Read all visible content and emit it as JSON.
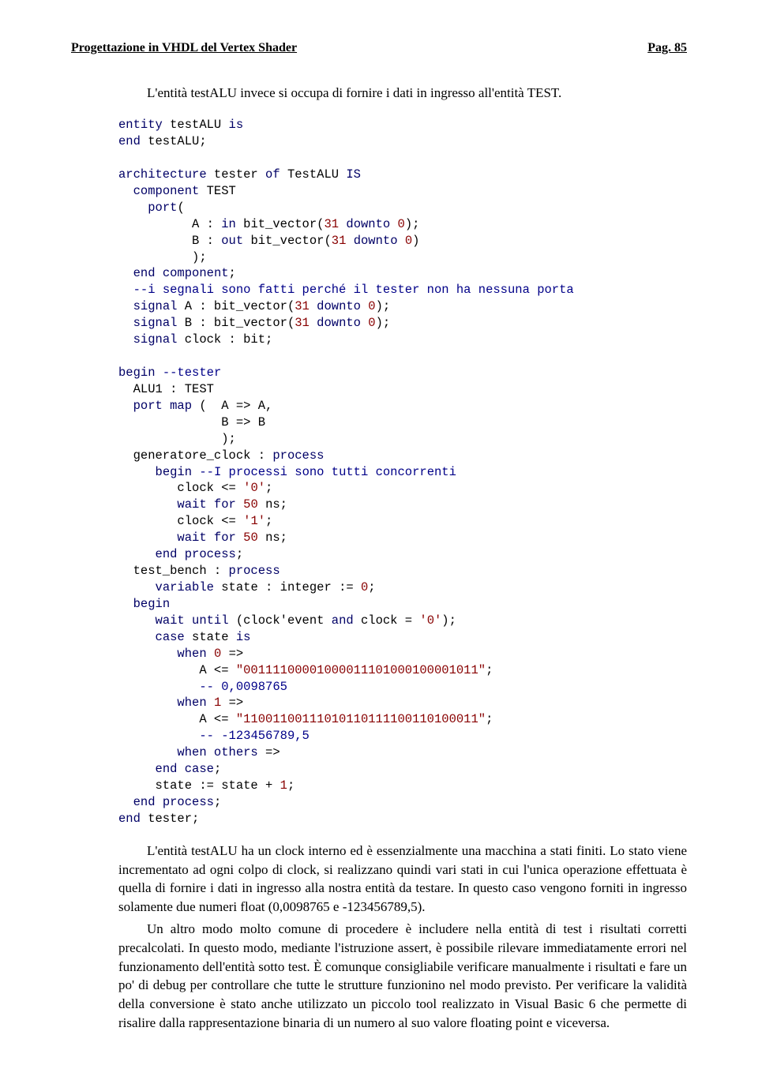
{
  "header": {
    "left": "Progettazione in VHDL del Vertex Shader",
    "right": "Pag. 85"
  },
  "para1_lead": "L'entità testALU invece si occupa di fornire i dati in ingresso all'entità TEST.",
  "code_lines": [
    [
      {
        "t": "entity",
        "c": "c-kw"
      },
      {
        "t": " testALU "
      },
      {
        "t": "is",
        "c": "c-kw"
      }
    ],
    [
      {
        "t": "end",
        "c": "c-kw"
      },
      {
        "t": " testALU;"
      }
    ],
    [],
    [
      {
        "t": "architecture",
        "c": "c-kw"
      },
      {
        "t": " tester "
      },
      {
        "t": "of",
        "c": "c-kw"
      },
      {
        "t": " TestALU "
      },
      {
        "t": "IS",
        "c": "c-kw"
      }
    ],
    [
      {
        "t": "  "
      },
      {
        "t": "component",
        "c": "c-kw"
      },
      {
        "t": " TEST"
      }
    ],
    [
      {
        "t": "    "
      },
      {
        "t": "port",
        "c": "c-kw"
      },
      {
        "t": "("
      }
    ],
    [
      {
        "t": "          A : "
      },
      {
        "t": "in",
        "c": "c-kw"
      },
      {
        "t": " bit_vector("
      },
      {
        "t": "31",
        "c": "c-num"
      },
      {
        "t": " "
      },
      {
        "t": "downto",
        "c": "c-kw"
      },
      {
        "t": " "
      },
      {
        "t": "0",
        "c": "c-num"
      },
      {
        "t": ");"
      }
    ],
    [
      {
        "t": "          B : "
      },
      {
        "t": "out",
        "c": "c-kw"
      },
      {
        "t": " bit_vector("
      },
      {
        "t": "31",
        "c": "c-num"
      },
      {
        "t": " "
      },
      {
        "t": "downto",
        "c": "c-kw"
      },
      {
        "t": " "
      },
      {
        "t": "0",
        "c": "c-num"
      },
      {
        "t": ")"
      }
    ],
    [
      {
        "t": "          );"
      }
    ],
    [
      {
        "t": "  "
      },
      {
        "t": "end",
        "c": "c-kw"
      },
      {
        "t": " "
      },
      {
        "t": "component",
        "c": "c-kw"
      },
      {
        "t": ";"
      }
    ],
    [
      {
        "t": "  "
      },
      {
        "t": "--i segnali sono fatti perché il tester non ha nessuna porta",
        "c": "c-cmt"
      }
    ],
    [
      {
        "t": "  "
      },
      {
        "t": "signal",
        "c": "c-kw"
      },
      {
        "t": " A : bit_vector("
      },
      {
        "t": "31",
        "c": "c-num"
      },
      {
        "t": " "
      },
      {
        "t": "downto",
        "c": "c-kw"
      },
      {
        "t": " "
      },
      {
        "t": "0",
        "c": "c-num"
      },
      {
        "t": ");"
      }
    ],
    [
      {
        "t": "  "
      },
      {
        "t": "signal",
        "c": "c-kw"
      },
      {
        "t": " B : bit_vector("
      },
      {
        "t": "31",
        "c": "c-num"
      },
      {
        "t": " "
      },
      {
        "t": "downto",
        "c": "c-kw"
      },
      {
        "t": " "
      },
      {
        "t": "0",
        "c": "c-num"
      },
      {
        "t": ");"
      }
    ],
    [
      {
        "t": "  "
      },
      {
        "t": "signal",
        "c": "c-kw"
      },
      {
        "t": " clock : bit;"
      }
    ],
    [],
    [
      {
        "t": "begin",
        "c": "c-kw"
      },
      {
        "t": " "
      },
      {
        "t": "--tester",
        "c": "c-cmt"
      }
    ],
    [
      {
        "t": "  ALU1 : TEST"
      }
    ],
    [
      {
        "t": "  "
      },
      {
        "t": "port map",
        "c": "c-kw"
      },
      {
        "t": " (  A => A,"
      }
    ],
    [
      {
        "t": "              B => B"
      }
    ],
    [
      {
        "t": "              );"
      }
    ],
    [
      {
        "t": "  generatore_clock : "
      },
      {
        "t": "process",
        "c": "c-kw"
      }
    ],
    [
      {
        "t": "     "
      },
      {
        "t": "begin",
        "c": "c-kw"
      },
      {
        "t": " "
      },
      {
        "t": "--I processi sono tutti concorrenti",
        "c": "c-cmt"
      }
    ],
    [
      {
        "t": "        clock <= "
      },
      {
        "t": "'0'",
        "c": "c-num"
      },
      {
        "t": ";"
      }
    ],
    [
      {
        "t": "        "
      },
      {
        "t": "wait for",
        "c": "c-kw"
      },
      {
        "t": " "
      },
      {
        "t": "50",
        "c": "c-num"
      },
      {
        "t": " ns;"
      }
    ],
    [
      {
        "t": "        clock <= "
      },
      {
        "t": "'1'",
        "c": "c-num"
      },
      {
        "t": ";"
      }
    ],
    [
      {
        "t": "        "
      },
      {
        "t": "wait for",
        "c": "c-kw"
      },
      {
        "t": " "
      },
      {
        "t": "50",
        "c": "c-num"
      },
      {
        "t": " ns;"
      }
    ],
    [
      {
        "t": "     "
      },
      {
        "t": "end process",
        "c": "c-kw"
      },
      {
        "t": ";"
      }
    ],
    [
      {
        "t": "  test_bench : "
      },
      {
        "t": "process",
        "c": "c-kw"
      }
    ],
    [
      {
        "t": "     "
      },
      {
        "t": "variable",
        "c": "c-kw"
      },
      {
        "t": " state : integer := "
      },
      {
        "t": "0",
        "c": "c-num"
      },
      {
        "t": ";"
      }
    ],
    [
      {
        "t": "  "
      },
      {
        "t": "begin",
        "c": "c-kw"
      }
    ],
    [
      {
        "t": "     "
      },
      {
        "t": "wait until",
        "c": "c-kw"
      },
      {
        "t": " (clock'event "
      },
      {
        "t": "and",
        "c": "c-kw"
      },
      {
        "t": " clock = "
      },
      {
        "t": "'0'",
        "c": "c-num"
      },
      {
        "t": ");"
      }
    ],
    [
      {
        "t": "     "
      },
      {
        "t": "case",
        "c": "c-kw"
      },
      {
        "t": " state "
      },
      {
        "t": "is",
        "c": "c-kw"
      }
    ],
    [
      {
        "t": "        "
      },
      {
        "t": "when",
        "c": "c-kw"
      },
      {
        "t": " "
      },
      {
        "t": "0",
        "c": "c-num"
      },
      {
        "t": " =>"
      }
    ],
    [
      {
        "t": "           A <= "
      },
      {
        "t": "\"00111100001000011101000100001011\"",
        "c": "c-num"
      },
      {
        "t": ";"
      }
    ],
    [
      {
        "t": "           "
      },
      {
        "t": "-- 0,0098765",
        "c": "c-cmt"
      }
    ],
    [
      {
        "t": "        "
      },
      {
        "t": "when",
        "c": "c-kw"
      },
      {
        "t": " "
      },
      {
        "t": "1",
        "c": "c-num"
      },
      {
        "t": " =>"
      }
    ],
    [
      {
        "t": "           A <= "
      },
      {
        "t": "\"11001100111010110111100110100011\"",
        "c": "c-num"
      },
      {
        "t": ";"
      }
    ],
    [
      {
        "t": "           "
      },
      {
        "t": "-- -123456789,5",
        "c": "c-cmt"
      }
    ],
    [
      {
        "t": "        "
      },
      {
        "t": "when others",
        "c": "c-kw"
      },
      {
        "t": " =>"
      }
    ],
    [
      {
        "t": "     "
      },
      {
        "t": "end case",
        "c": "c-kw"
      },
      {
        "t": ";"
      }
    ],
    [
      {
        "t": "     state := state + "
      },
      {
        "t": "1",
        "c": "c-num"
      },
      {
        "t": ";"
      }
    ],
    [
      {
        "t": "  "
      },
      {
        "t": "end process",
        "c": "c-kw"
      },
      {
        "t": ";"
      }
    ],
    [
      {
        "t": "end",
        "c": "c-kw"
      },
      {
        "t": " tester;"
      }
    ]
  ],
  "para2": "L'entità testALU ha un clock interno ed è essenzialmente una macchina a stati finiti. Lo stato viene incrementato ad ogni colpo di clock, si realizzano quindi vari stati in cui l'unica operazione effettuata è quella di fornire i dati in ingresso alla nostra entità da testare. In questo caso vengono forniti in ingresso solamente due numeri float (0,0098765 e -123456789,5).",
  "para3": "Un altro modo molto comune di procedere è includere nella entità di test i risultati corretti precalcolati. In questo modo, mediante l'istruzione assert, è possibile rilevare immediatamente errori nel funzionamento dell'entità sotto test. È comunque consigliabile verificare manualmente i risultati e fare un po' di debug per controllare che tutte le strutture funzionino nel modo previsto. Per verificare la validità della conversione è stato anche utilizzato un piccolo tool realizzato in Visual Basic 6 che permette di risalire dalla rappresentazione binaria di un numero al suo valore floating point e viceversa."
}
